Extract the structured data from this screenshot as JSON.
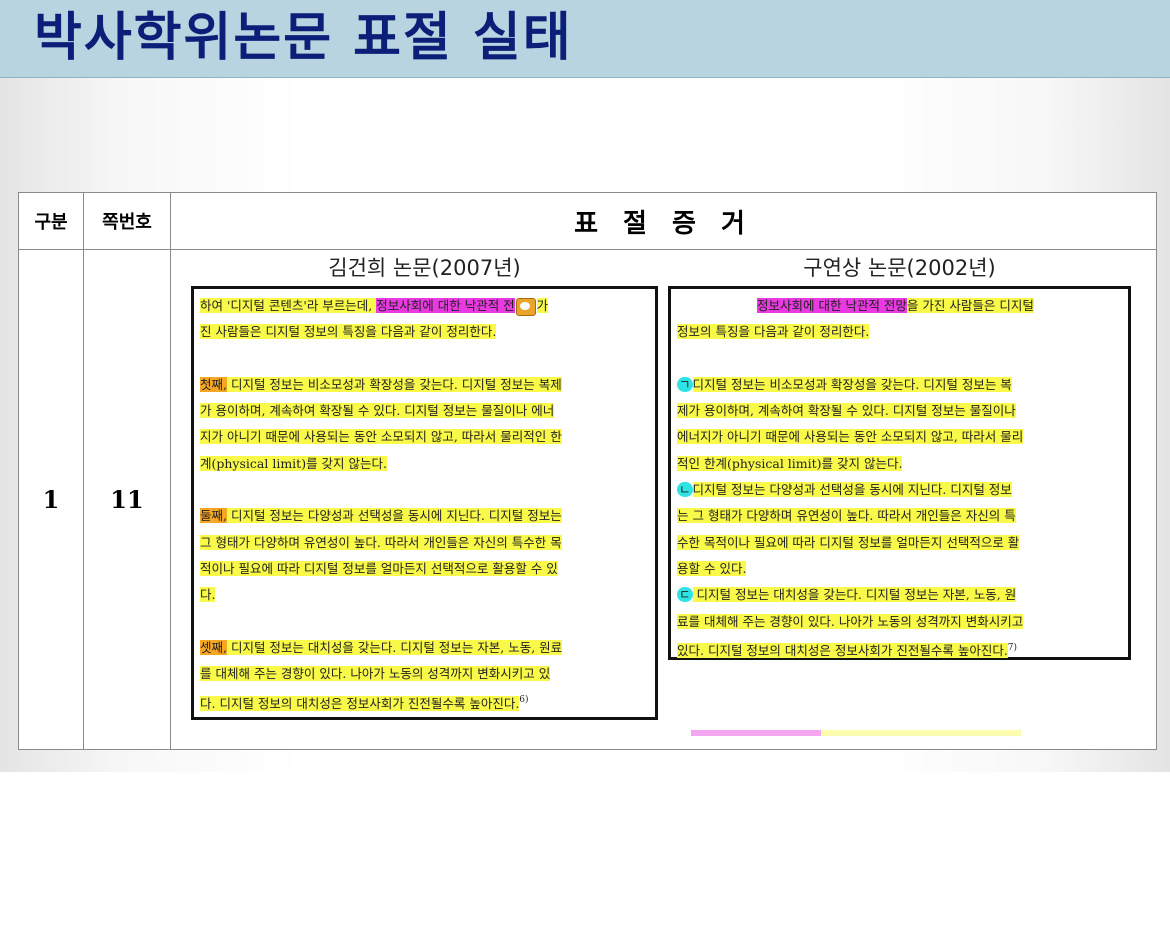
{
  "title": "박사학위논문 표절 실태",
  "table": {
    "headers": {
      "category": "구분",
      "page": "쪽번호",
      "evidence": "표 절 증 거"
    },
    "row": {
      "category": "1",
      "page": "11"
    }
  },
  "left_paper": {
    "title": "김건희 논문(2007년)",
    "lines": [
      {
        "plain": "하여 '디지털 콘텐츠'라 부르는데, ",
        "pink": "정보사회에 대한 낙관적 전",
        "after_icon": "가"
      },
      {
        "text": "진 사람들은 디지털 정보의 특징을 다음과 같이 정리한다."
      },
      {
        "text": ""
      },
      {
        "marker": "첫째,",
        "text": " 디지털 정보는 비소모성과 확장성을 갖는다. 디지털 정보는 복제"
      },
      {
        "text": "가 용이하며, 계속하여 확장될 수 있다. 디지털 정보는 물질이나 에너"
      },
      {
        "text": "지가 아니기 때문에 사용되는 동안 소모되지 않고, 따라서 물리적인 한"
      },
      {
        "text": "계(physical limit)를 갖지 않는다."
      },
      {
        "text": ""
      },
      {
        "marker": "둘째,",
        "text": " 디지털 정보는 다양성과 선택성을 동시에 지닌다. 디지털 정보는"
      },
      {
        "text": "그 형태가 다양하며 유연성이 높다. 따라서 개인들은 자신의 특수한 목"
      },
      {
        "text": "적이나 필요에 따라 디지털 정보를 얼마든지 선택적으로 활용할 수 있"
      },
      {
        "text": "다."
      },
      {
        "text": ""
      },
      {
        "marker": "셋째,",
        "text": " 디지털 정보는 대치성을 갖는다. 디지털 정보는 자본, 노동, 원료"
      },
      {
        "text": "를 대체해 주는 경향이 있다. 나아가 노동의 성격까지 변화시키고 있"
      },
      {
        "text": "다. 디지털 정보의 대치성은 정보사회가 진전될수록 높아진다.",
        "footnote": "6)"
      }
    ]
  },
  "right_paper": {
    "title": "구연상 논문(2002년)",
    "lines": [
      {
        "pink": "정보사회에 대한 낙관적 전망",
        "text": "을 가진 사람들은 디지털"
      },
      {
        "text": "정보의 특징을 다음과 같이 정리한다."
      },
      {
        "text": ""
      },
      {
        "marker": "ㄱ",
        "text": "디지털 정보는 비소모성과 확장성을 갖는다. 디지털 정보는 복"
      },
      {
        "text": "제가 용이하며, 계속하여 확장될 수 있다. 디지털 정보는 물질이나"
      },
      {
        "text": "에너지가 아니기 때문에 사용되는 동안 소모되지 않고, 따라서 물리"
      },
      {
        "text": "적인 한계(physical limit)를 갖지 않는다."
      },
      {
        "marker": "ㄴ",
        "text": "디지털 정보는 다양성과 선택성을 동시에 지닌다. 디지털 정보"
      },
      {
        "text": "는 그 형태가 다양하며 유연성이 높다. 따라서 개인들은 자신의 특"
      },
      {
        "text": "수한 목적이나 필요에 따라 디지털 정보를 얼마든지 선택적으로 활"
      },
      {
        "text": "용할 수 있다."
      },
      {
        "marker": "ㄷ",
        "text": " 디지털 정보는 대치성을 갖는다. 디지털 정보는 자본, 노동, 원"
      },
      {
        "text": "료를 대체해 주는 경향이 있다. 나아가 노동의 성격까지 변화시키고"
      },
      {
        "text": "있다. 디지털 정보의 대치성은 정보사회가 진전될수록 높아진다.",
        "footnote": "7)"
      }
    ]
  },
  "colors": {
    "title_bar": "#b8d4e0",
    "title_text": "#0b1f78",
    "highlight_yellow": "#f9f94a",
    "highlight_pink": "#e83ae0",
    "highlight_orange": "#f5a623",
    "highlight_cyan": "#2ee3e3"
  },
  "icons": [
    "comment-icon"
  ]
}
